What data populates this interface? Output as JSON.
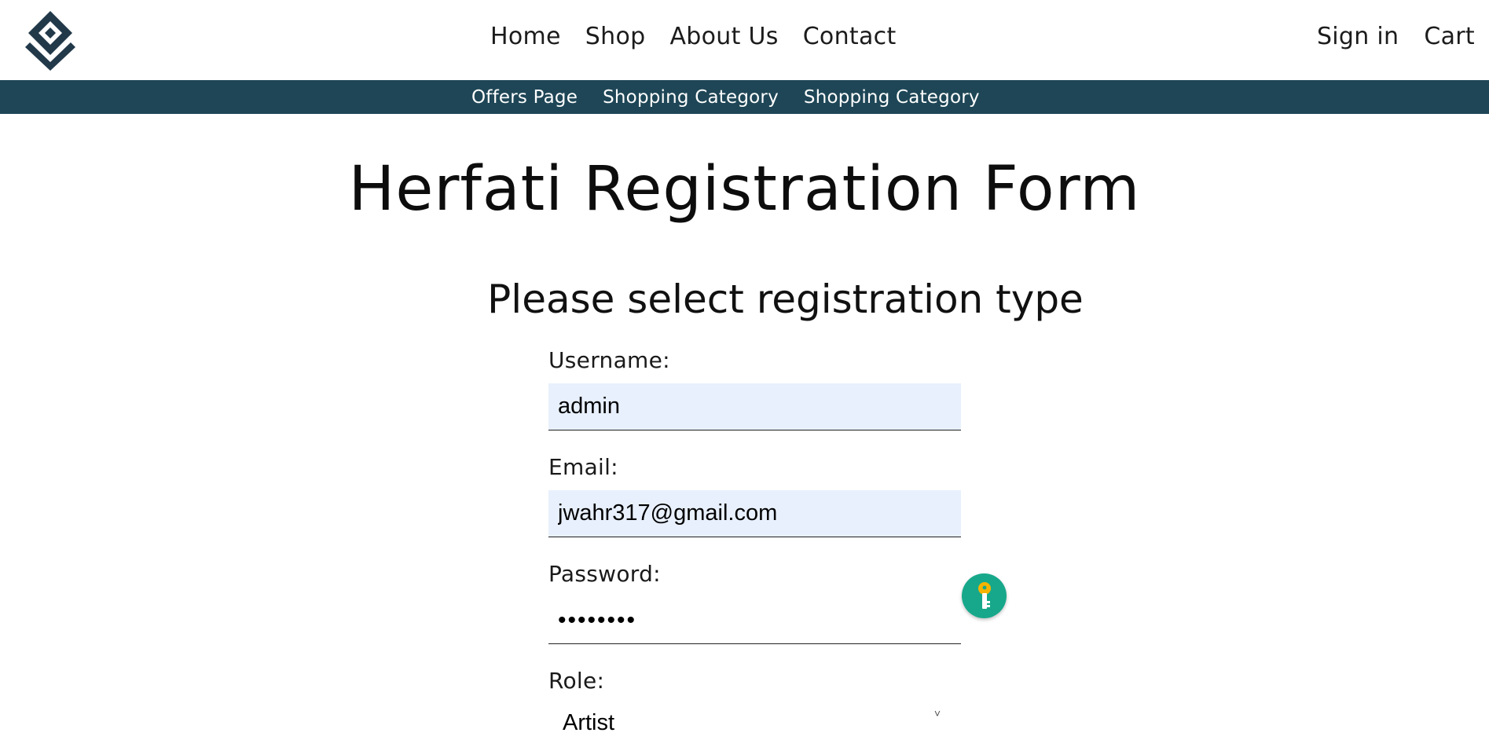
{
  "header": {
    "logo_icon": "diamond-logo-icon",
    "nav": [
      {
        "label": "Home"
      },
      {
        "label": "Shop"
      },
      {
        "label": "About Us"
      },
      {
        "label": "Contact"
      }
    ],
    "right_nav": [
      {
        "label": "Sign in"
      },
      {
        "label": "Cart"
      }
    ]
  },
  "subnav": {
    "background": "#1e4656",
    "items": [
      {
        "label": "Offers Page"
      },
      {
        "label": "Shopping Category"
      },
      {
        "label": "Shopping Category"
      }
    ]
  },
  "page": {
    "title": "Herfati Registration Form",
    "subtitle": "Please select registration type"
  },
  "form": {
    "username_label": "Username:",
    "username_value": "admin",
    "email_label": "Email:",
    "email_value": "jwahr317@gmail.com",
    "password_label": "Password:",
    "password_value": "••••••••",
    "role_label": "Role:",
    "role_value": "Artist"
  },
  "password_manager": {
    "icon": "key-icon",
    "color": "#17a88b"
  }
}
